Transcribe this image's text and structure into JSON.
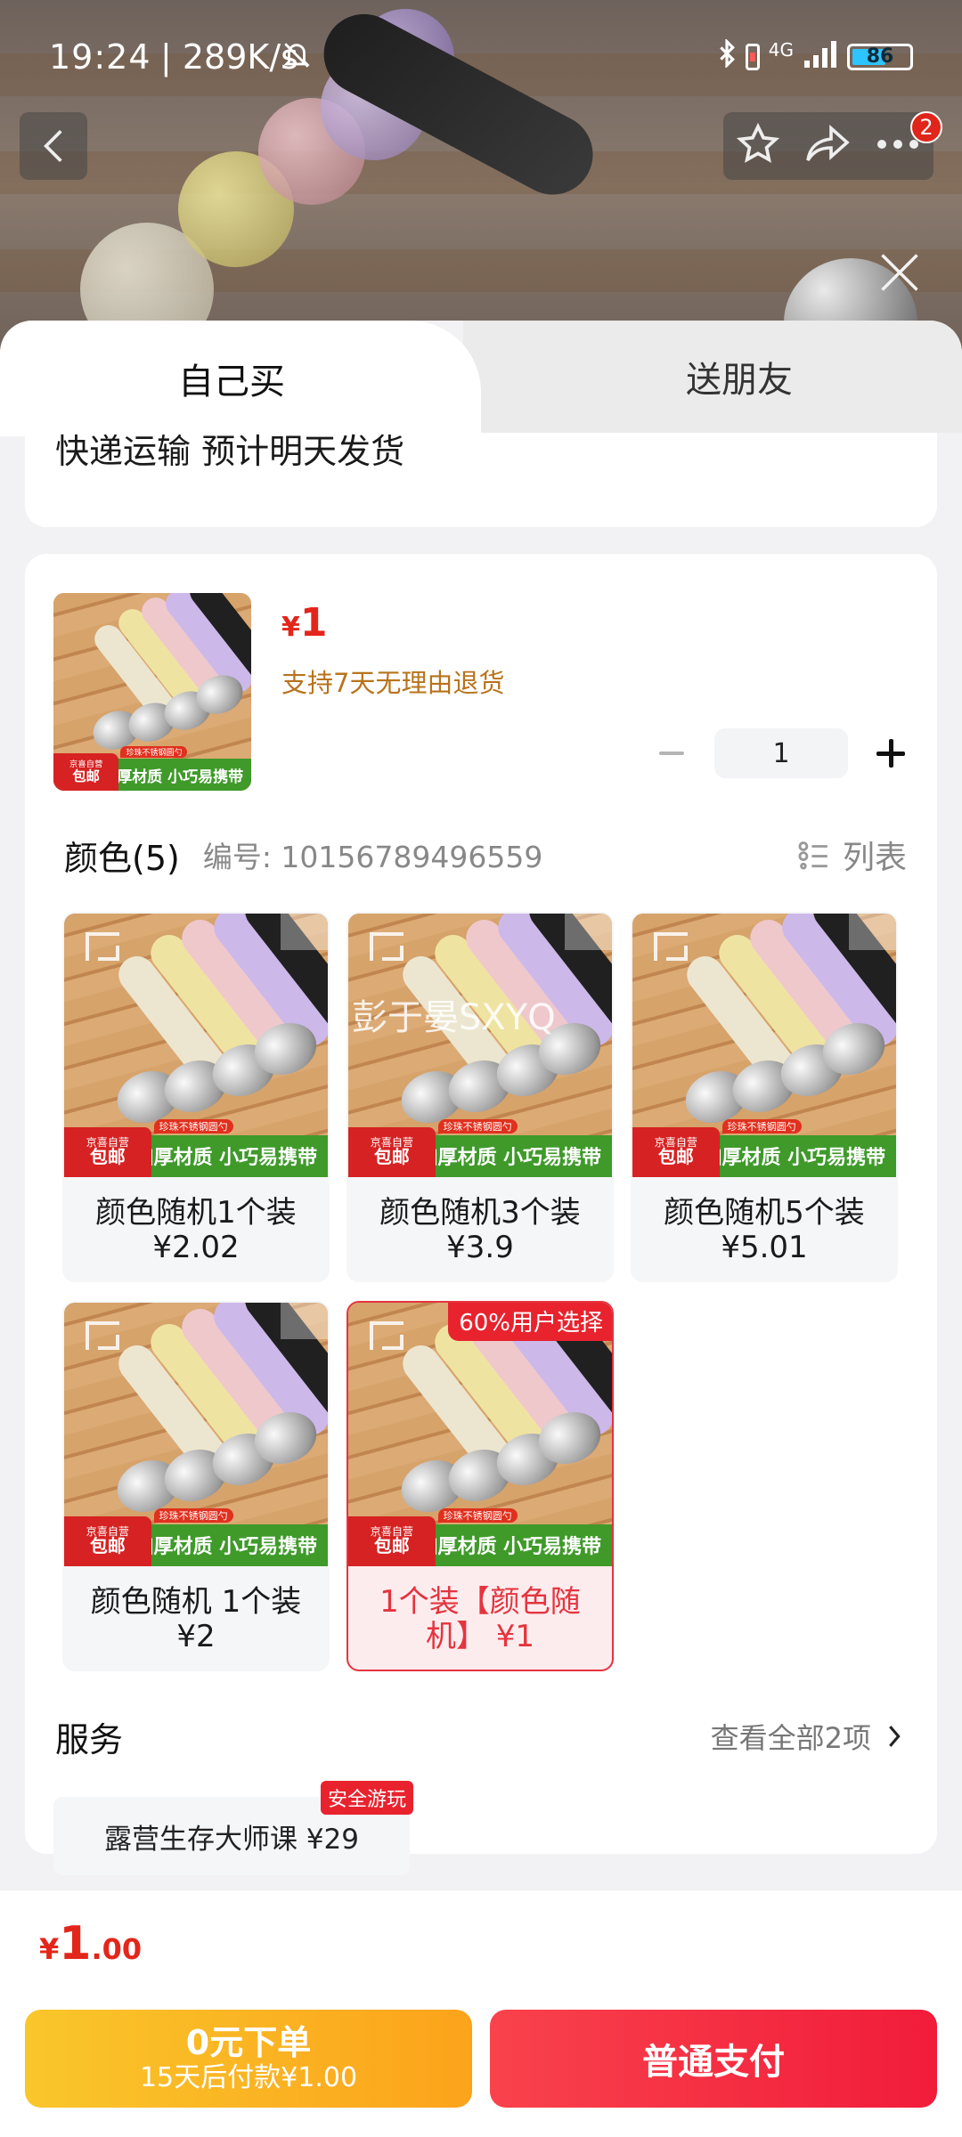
{
  "status_bar": {
    "time": "19:24",
    "net_speed": "| 289K/s",
    "network": "4G",
    "battery": "86"
  },
  "header": {
    "notification_count": "2"
  },
  "tabs": [
    {
      "label": "自己买"
    },
    {
      "label": "送朋友"
    }
  ],
  "shipping": {
    "text": "快递运输 预计明天发货"
  },
  "product": {
    "price_symbol": "¥",
    "price": "1",
    "return_policy": "支持7天无理由退货",
    "quantity": "1",
    "thumb_jd_line1": "京喜自营",
    "thumb_jd_line2": "包邮",
    "thumb_tagline": "珍珠不锈钢圆勺",
    "thumb_footer": "加厚材质 小巧易携带"
  },
  "options": {
    "title": "颜色(5)",
    "sku": "编号: 10156789496559",
    "view_toggle": "列表",
    "items": [
      {
        "name": "颜色随机1个装",
        "price": "¥2.02"
      },
      {
        "name": "颜色随机3个装",
        "price": "¥3.9"
      },
      {
        "name": "颜色随机5个装",
        "price": "¥5.01"
      },
      {
        "name": "颜色随机 1个装",
        "price": "¥2"
      },
      {
        "name": "1个装【颜色随机】 ¥1",
        "badge": "60%用户选择",
        "selected": true
      }
    ]
  },
  "watermark": "彭于晏SXYQ",
  "services": {
    "title": "服务",
    "view_all": "查看全部2项",
    "item": "露营生存大师课  ¥29",
    "tag": "安全游玩"
  },
  "footer": {
    "total_symbol": "¥",
    "total_int": "1",
    "total_dec": ".00",
    "credit_title": "0元下单",
    "credit_sub": "15天后付款¥1.00",
    "pay_label": "普通支付"
  },
  "colors": {
    "accent": "#e3261b",
    "pay": "#f11c3a",
    "credit": "#fca31b",
    "return": "#b8731c"
  }
}
